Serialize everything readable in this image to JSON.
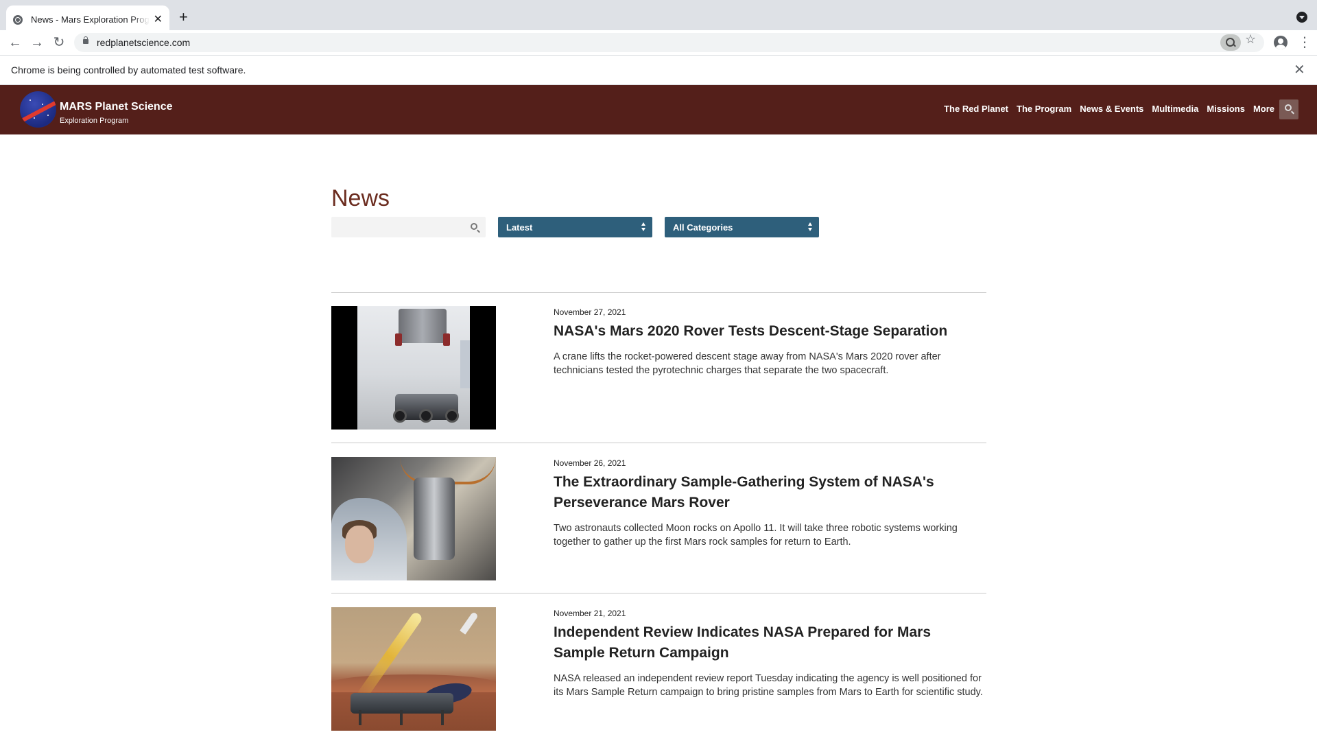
{
  "browser": {
    "tab_title": "News - Mars Exploration Program",
    "new_tab": "+",
    "url": "redplanetscience.com",
    "infobar_message": "Chrome is being controlled by automated test software.",
    "infobar_close": "✕"
  },
  "site": {
    "brand_title": "MARS Planet Science",
    "brand_subtitle": "Exploration Program",
    "nav": [
      "The Red Planet",
      "The Program",
      "News & Events",
      "Multimedia",
      "Missions",
      "More"
    ]
  },
  "news": {
    "page_title": "News",
    "search_value": "",
    "sort_selected": "Latest",
    "category_selected": "All Categories",
    "articles": [
      {
        "date": "November 27, 2021",
        "headline": "NASA's Mars 2020 Rover Tests Descent-Stage Separation",
        "teaser": "A crane lifts the rocket-powered descent stage away from NASA's Mars 2020 rover after technicians tested the pyrotechnic charges that separate the two spacecraft."
      },
      {
        "date": "November 26, 2021",
        "headline": "The Extraordinary Sample-Gathering System of NASA's Perseverance Mars Rover",
        "teaser": "Two astronauts collected Moon rocks on Apollo 11. It will take three robotic systems working together to gather up the first Mars rock samples for return to Earth."
      },
      {
        "date": "November 21, 2021",
        "headline": "Independent Review Indicates NASA Prepared for Mars Sample Return Campaign",
        "teaser": "NASA released an independent review report Tuesday indicating the agency is well positioned for its Mars Sample Return campaign to bring pristine samples from Mars to Earth for scientific study."
      }
    ]
  },
  "colors": {
    "header_bg": "#541f1a",
    "select_bg": "#2e5f7b",
    "title_color": "#6b2c1f"
  }
}
